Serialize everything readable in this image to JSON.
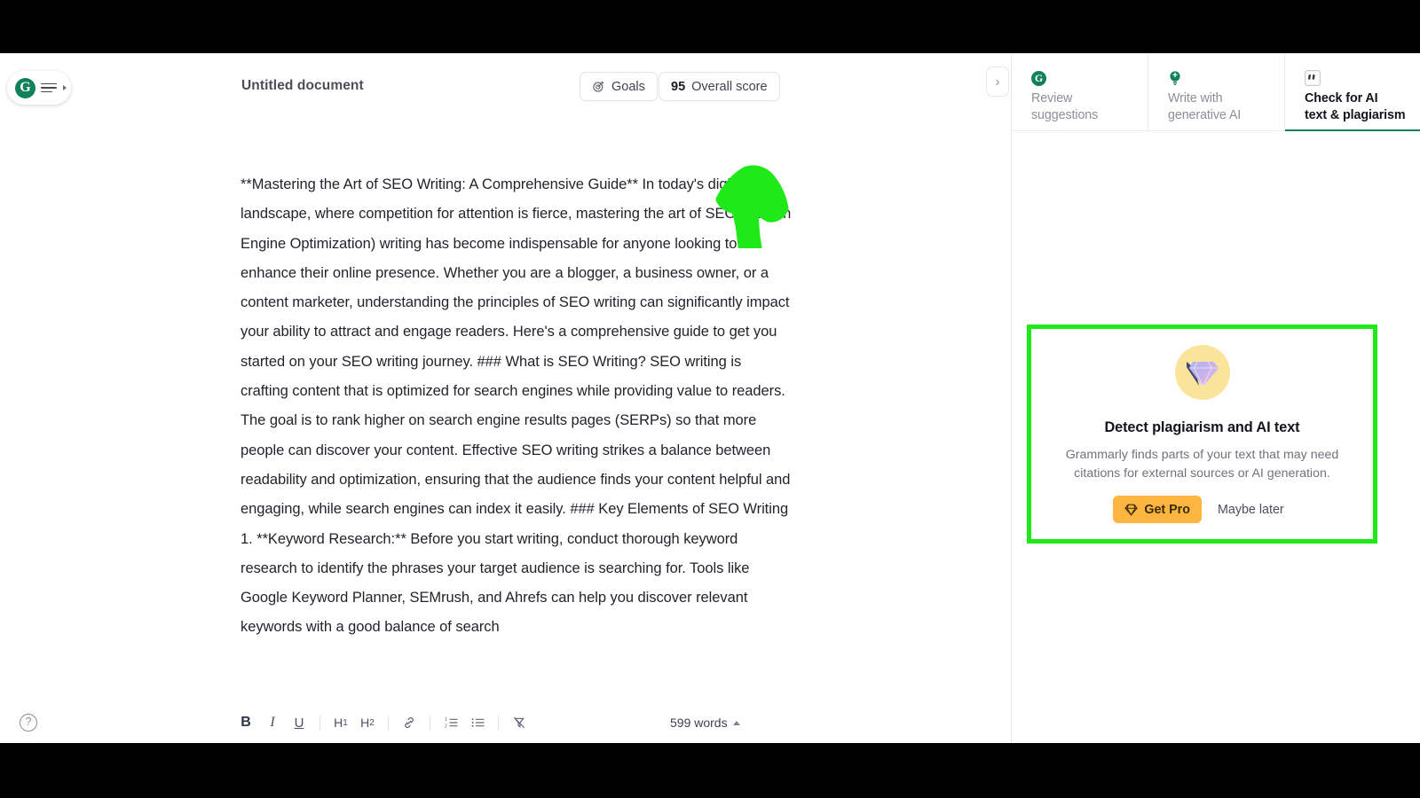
{
  "app": {
    "name": "Grammarly Editor"
  },
  "header": {
    "document_title": "Untitled document",
    "logo_letter": "G",
    "goals_button": "Goals",
    "score_value": "95",
    "score_label": "Overall score"
  },
  "document": {
    "body": "**Mastering the Art of SEO Writing: A Comprehensive Guide** In today's digital landscape, where competition for attention is fierce, mastering the art of SEO (Search Engine Optimization) writing has become indispensable for anyone looking to enhance their online presence. Whether you are a blogger, a business owner, or a content marketer, understanding the principles of SEO writing can significantly impact your ability to attract and engage readers. Here's a comprehensive guide to get you started on your SEO writing journey. ### What is SEO Writing? SEO writing is crafting content that is optimized for search engines while providing value to readers. The goal is to rank higher on search engine results pages (SERPs) so that more people can discover your content. Effective SEO writing strikes a balance between readability and optimization, ensuring that the audience finds your content helpful and engaging, while search engines can index it easily. ### Key Elements of SEO Writing 1. **Keyword Research:** Before you start writing, conduct thorough keyword research to identify the phrases your target audience is searching for. Tools like Google Keyword Planner, SEMrush, and Ahrefs can help you discover relevant keywords with a good balance of search"
  },
  "format_toolbar": {
    "bold": "B",
    "italic": "I",
    "underline": "U",
    "heading1": "H",
    "heading1_sub": "1",
    "heading2": "H",
    "heading2_sub": "2",
    "word_count": "599 words",
    "help": "?"
  },
  "right_panel": {
    "collapse_chevron": "›",
    "tabs": [
      {
        "label_line1": "Review",
        "label_line2": "suggestions",
        "icon": "grammarly-logo-icon",
        "active": false
      },
      {
        "label_line1": "Write with",
        "label_line2": "generative AI",
        "icon": "lightbulb-icon",
        "active": false
      },
      {
        "label_line1": "Check for AI",
        "label_line2": "text & plagiarism",
        "icon": "quote-icon",
        "active": true
      }
    ],
    "promo": {
      "title": "Detect plagiarism and AI text",
      "description": "Grammarly finds parts of your text that may need citations for external sources or AI generation.",
      "primary_button": "Get Pro",
      "secondary_button": "Maybe later"
    }
  },
  "colors": {
    "brand_green": "#11815b",
    "annotation_green": "#20e91a",
    "pro_amber": "#fcb63f",
    "gem_circle": "#f9e49a"
  }
}
